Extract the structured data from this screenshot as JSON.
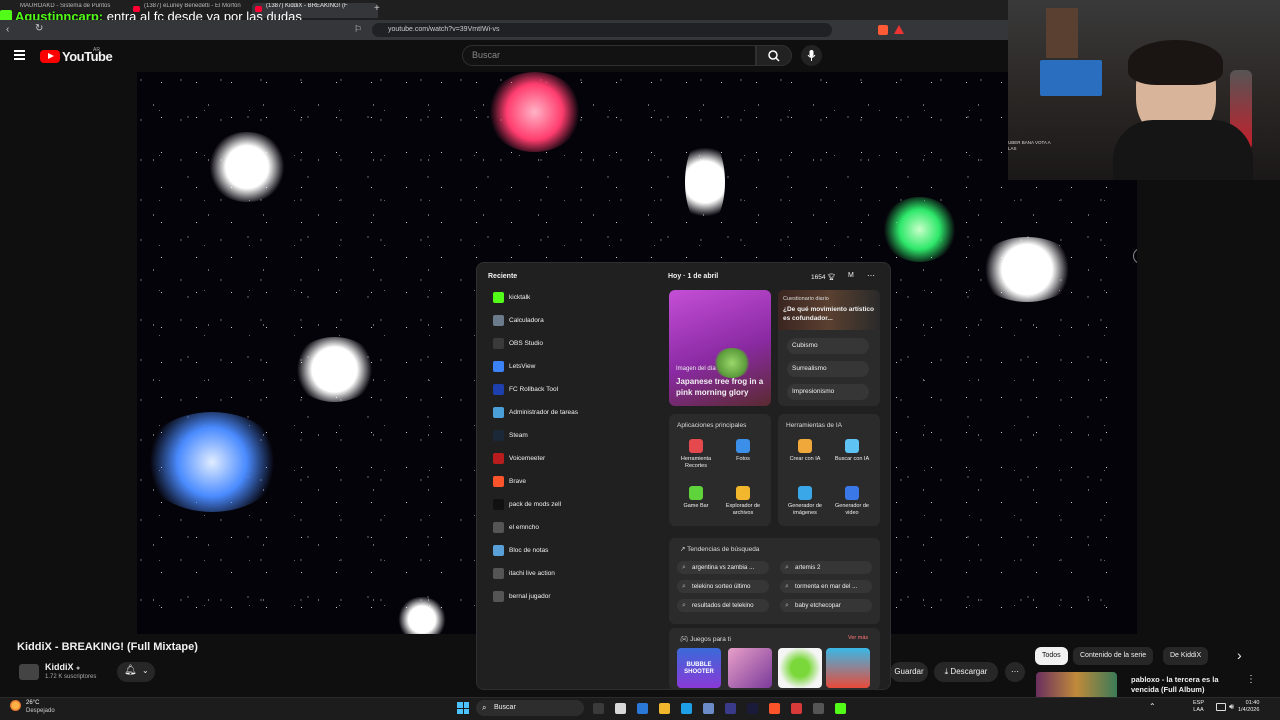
{
  "browser": {
    "tabs": [
      {
        "label": "MAUROAKD - Sistema de Puntos"
      },
      {
        "label": "(1387) eLuney Benedetti - El Morfón"
      },
      {
        "label": "(1387) KiddiX - BREAKING! (F"
      }
    ],
    "new_tab_symbol": "+",
    "url": "youtube.com/watch?v=39VmtIWi-vs"
  },
  "chat_overlay": {
    "user": "Agustinncarp:",
    "message": "entra al fc desde ya por las dudas"
  },
  "youtube": {
    "logo_text": "YouTube",
    "country_code": "AR",
    "search_placeholder": "Buscar",
    "video_title": "KiddiX - BREAKING! (Full Mixtape)",
    "channel_name": "KiddiX",
    "channel_subs": "1.72 K suscriptores",
    "save_label": "Guardar",
    "download_label": "Descargar",
    "more_symbol": "⋯",
    "chips": [
      "Todos",
      "Contenido de la serie",
      "De KiddiX"
    ],
    "next_symbol": "›",
    "recommendation_title": "pabloxo - la tercera es la vencida (Full Album)"
  },
  "start_menu": {
    "recent_heading": "Reciente",
    "recent_items": [
      {
        "label": "kicktalk",
        "color": "#53fc18"
      },
      {
        "label": "Calculadora",
        "color": "#6b7b8c"
      },
      {
        "label": "OBS Studio",
        "color": "#3a3a3a"
      },
      {
        "label": "LetsView",
        "color": "#3b82f6"
      },
      {
        "label": "FC Rollback Tool",
        "color": "#1e40af"
      },
      {
        "label": "Administrador de tareas",
        "color": "#4a9fd8"
      },
      {
        "label": "Steam",
        "color": "#1b2838"
      },
      {
        "label": "Voicemeeter",
        "color": "#b91c1c"
      },
      {
        "label": "Brave",
        "color": "#fb542b"
      },
      {
        "label": "pack de mods zell",
        "color": "#111111"
      },
      {
        "label": "el emncho",
        "color": "#555555"
      },
      {
        "label": "Bloc de notas",
        "color": "#5aa0d8"
      },
      {
        "label": "itachi live action",
        "color": "#555555"
      },
      {
        "label": "bernal jugador",
        "color": "#555555"
      }
    ],
    "widget_date_day": "Hoy",
    "widget_date": "1 de abril",
    "widget_count": "1654",
    "widget_profile": "M",
    "widget_more": "⋯",
    "image_of_day_label": "Imagen del día",
    "image_of_day_title": "Japanese tree frog in a pink morning glory",
    "quiz_kicker": "Cuestionario diario",
    "quiz_question": "¿De qué movimiento artístico es cofundador...",
    "quiz_options": [
      "Cubismo",
      "Surrealismo",
      "Impresionismo"
    ],
    "main_apps_title": "Aplicaciones principales",
    "main_apps": [
      {
        "label": "Herramienta Recortes",
        "color": "#e5484d"
      },
      {
        "label": "Fotos",
        "color": "#3b8fe8"
      },
      {
        "label": "Game Bar",
        "color": "#5fd43a"
      },
      {
        "label": "Explorador de archivos",
        "color": "#f2b72c"
      }
    ],
    "ai_tools_title": "Herramientas de IA",
    "ai_tools": [
      {
        "label": "Crear con IA",
        "color": "#f0a83a"
      },
      {
        "label": "Buscar con IA",
        "color": "#5ec2f2"
      },
      {
        "label": "Generador de imágenes",
        "color": "#3aa8e8"
      },
      {
        "label": "Generador de video",
        "color": "#3a78e8"
      }
    ],
    "trends_title": "Tendencias de búsqueda",
    "trends": [
      "argentina vs zambia ...",
      "artemis 2",
      "telekino sorteo último",
      "tormenta en mar del ...",
      "resultados del telekino",
      "baby etchecopar"
    ],
    "games_title": "Juegos para ti",
    "games_see_more": "Ver más",
    "game_tile_text": "BUBBLE SHOOTER"
  },
  "taskbar": {
    "weather_temp": "26°C",
    "weather_condition": "Despejado",
    "search_label": "Buscar",
    "lang_top": "ESP",
    "lang_bottom": "LAA",
    "time": "01:40",
    "date": "1/4/2026"
  },
  "webcam": {
    "sticker_text": "UBER BANA VOTA A LAS"
  }
}
